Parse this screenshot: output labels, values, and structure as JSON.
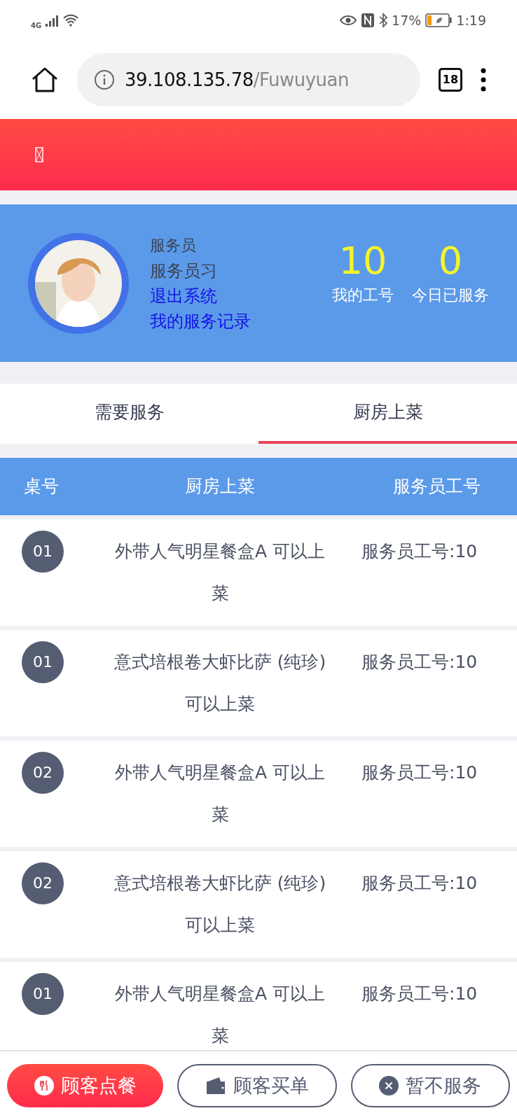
{
  "status_bar": {
    "network": "4G",
    "battery": "17%",
    "time": "1:19"
  },
  "browser": {
    "url_host": "39.108.135.78",
    "url_path": "/Fuwuyuan",
    "tab_count": "18"
  },
  "profile": {
    "role": "服务员",
    "name": "服务员习",
    "links": [
      "退出系统",
      "我的服务记录"
    ],
    "stats": [
      {
        "value": "10",
        "label": "我的工号"
      },
      {
        "value": "0",
        "label": "今日已服务"
      }
    ]
  },
  "tabs": [
    {
      "label": "需要服务",
      "selected": false
    },
    {
      "label": "厨房上菜",
      "selected": true
    }
  ],
  "table": {
    "columns": [
      "桌号",
      "厨房上菜",
      "服务员工号"
    ],
    "rows": [
      {
        "table_no": "01",
        "dish": "外带人气明星餐盒A 可以上菜",
        "staff": "服务员工号:10"
      },
      {
        "table_no": "01",
        "dish": "意式培根卷大虾比萨 (纯珍)可以上菜",
        "staff": "服务员工号:10"
      },
      {
        "table_no": "02",
        "dish": "外带人气明星餐盒A 可以上菜",
        "staff": "服务员工号:10"
      },
      {
        "table_no": "02",
        "dish": "意式培根卷大虾比萨 (纯珍)可以上菜",
        "staff": "服务员工号:10"
      },
      {
        "table_no": "01",
        "dish": "外带人气明星餐盒A 可以上菜",
        "staff": "服务员工号:10"
      }
    ]
  },
  "bottom_buttons": [
    {
      "kind": "order",
      "label": "顾客点餐"
    },
    {
      "kind": "bill",
      "label": "顾客买单"
    },
    {
      "kind": "decline",
      "label": "暂不服务"
    }
  ]
}
